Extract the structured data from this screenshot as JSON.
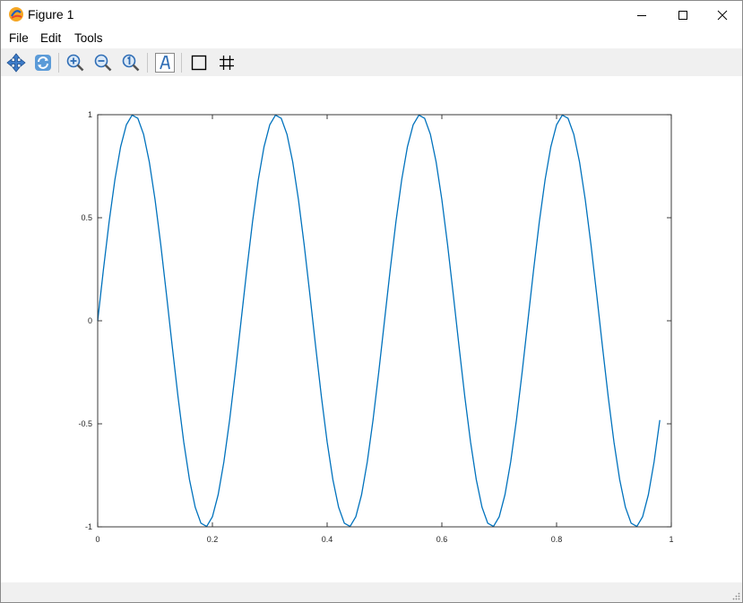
{
  "window": {
    "title": "Figure 1"
  },
  "menu": {
    "file": "File",
    "edit": "Edit",
    "tools": "Tools"
  },
  "toolbar": {
    "icons": [
      "pan-icon",
      "rotate-icon",
      "zoom-in-icon",
      "zoom-out-icon",
      "zoom-reset-icon",
      "insert-text-icon",
      "axes-box-icon",
      "grid-icon"
    ]
  },
  "chart_data": {
    "type": "line",
    "title": "",
    "xlabel": "",
    "ylabel": "",
    "xlim": [
      0,
      1
    ],
    "ylim": [
      -1,
      1
    ],
    "xticks": [
      "0",
      "0.2",
      "0.4",
      "0.6",
      "0.8",
      "1"
    ],
    "yticks": [
      "1",
      "0.5",
      "0",
      "-0.5",
      "-1"
    ],
    "xtick_values": [
      0,
      0.2,
      0.4,
      0.6,
      0.8,
      1
    ],
    "ytick_values": [
      1,
      0.5,
      0,
      -0.5,
      -1
    ],
    "grid": false,
    "line_color": "#0072bd",
    "series": [
      {
        "function": "sin(2*pi*4*x)",
        "x_start": 0,
        "x_end": 0.98,
        "x_step": 0.01
      }
    ]
  }
}
